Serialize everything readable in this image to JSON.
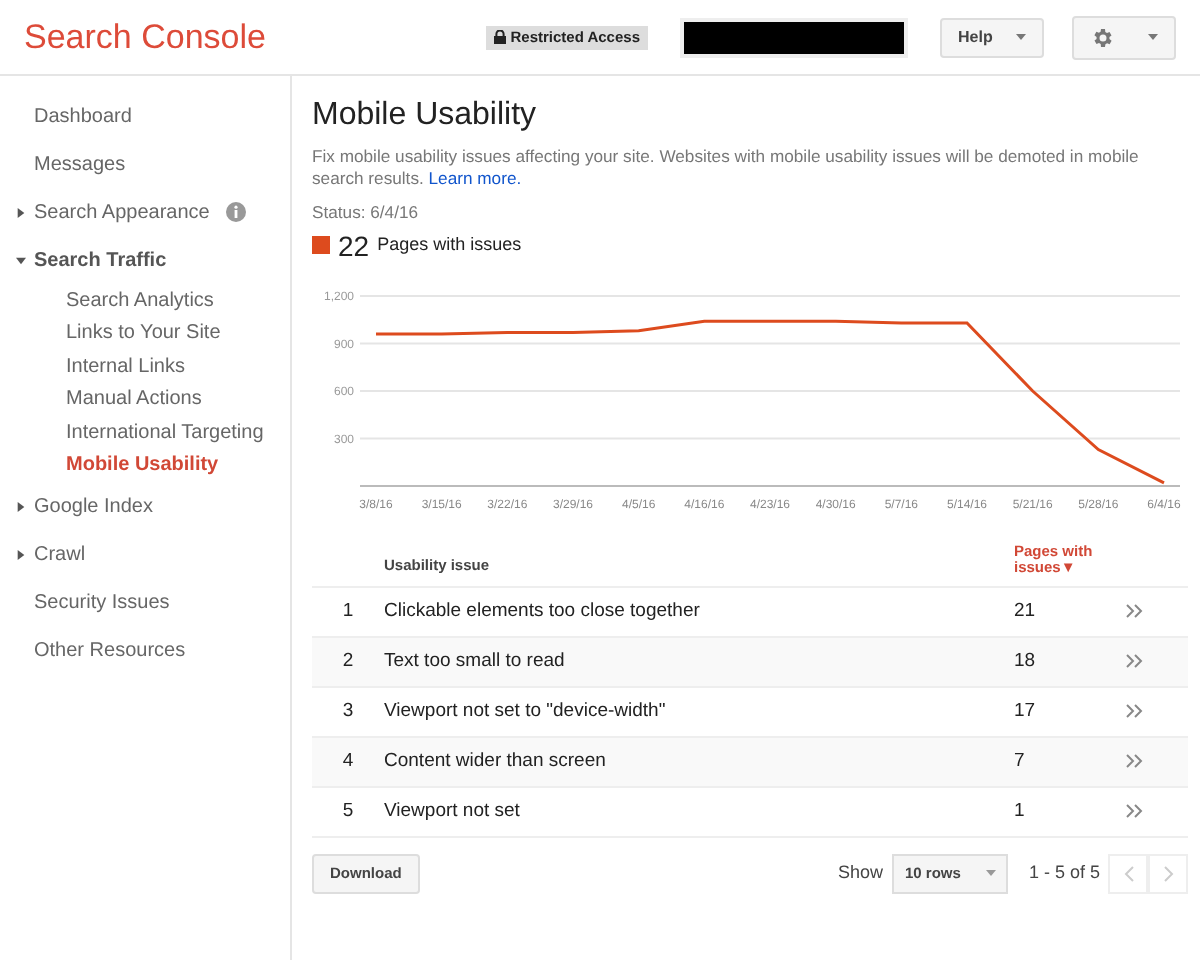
{
  "header": {
    "logo": "Search Console",
    "badge": "Restricted Access",
    "help": "Help"
  },
  "sidebar": {
    "items": [
      {
        "label": "Dashboard",
        "selected": false
      },
      {
        "label": "Messages",
        "selected": false
      },
      {
        "label": "Search Appearance",
        "selected": false,
        "expanded": false,
        "info": true
      },
      {
        "label": "Search Traffic",
        "selected": false,
        "expanded": true,
        "children": [
          {
            "label": "Search Analytics",
            "selected": false
          },
          {
            "label": "Links to Your Site",
            "selected": false
          },
          {
            "label": "Internal Links",
            "selected": false
          },
          {
            "label": "Manual Actions",
            "selected": false
          },
          {
            "label": "International Targeting",
            "selected": false
          },
          {
            "label": "Mobile Usability",
            "selected": true
          }
        ]
      },
      {
        "label": "Google Index",
        "selected": false,
        "expanded": false
      },
      {
        "label": "Crawl",
        "selected": false,
        "expanded": false
      },
      {
        "label": "Security Issues",
        "selected": false
      },
      {
        "label": "Other Resources",
        "selected": false
      }
    ]
  },
  "main": {
    "title": "Mobile Usability",
    "description": "Fix mobile usability issues affecting your site. Websites with mobile usability issues will be demoted in mobile search results.",
    "learn_more": "Learn more.",
    "status": "Status: 6/4/16",
    "count": "22",
    "count_label": "Pages with issues",
    "chart_data": {
      "type": "line",
      "categories": [
        "3/8/16",
        "3/15/16",
        "3/22/16",
        "3/29/16",
        "4/5/16",
        "4/16/16",
        "4/23/16",
        "4/30/16",
        "5/7/16",
        "5/14/16",
        "5/21/16",
        "5/28/16",
        "6/4/16"
      ],
      "series": [
        {
          "color": "#dd4b1e",
          "values": [
            960,
            960,
            970,
            970,
            980,
            1040,
            1040,
            1040,
            1030,
            1030,
            600,
            230,
            20
          ]
        }
      ],
      "grid": true,
      "ylim": [
        0,
        1200
      ],
      "yticks": [
        {
          "value": 300,
          "label": "300"
        },
        {
          "value": 600,
          "label": "600"
        },
        {
          "value": 900,
          "label": "900"
        },
        {
          "value": 1200,
          "label": "1,200"
        }
      ]
    },
    "table": {
      "columns": [
        "Usability issue",
        "Pages with issues"
      ],
      "sort_mark": "▼",
      "rows": [
        {
          "index": "1",
          "issue": "Clickable elements too close together",
          "pages": "21"
        },
        {
          "index": "2",
          "issue": "Text too small to read",
          "pages": "18"
        },
        {
          "index": "3",
          "issue": "Viewport not set to \"device-width\"",
          "pages": "17"
        },
        {
          "index": "4",
          "issue": "Content wider than screen",
          "pages": "7"
        },
        {
          "index": "5",
          "issue": "Viewport not set",
          "pages": "1"
        }
      ]
    },
    "footer": {
      "download": "Download",
      "show": "Show",
      "rows_select": "10 rows",
      "range": "1 - 5 of 5"
    }
  }
}
